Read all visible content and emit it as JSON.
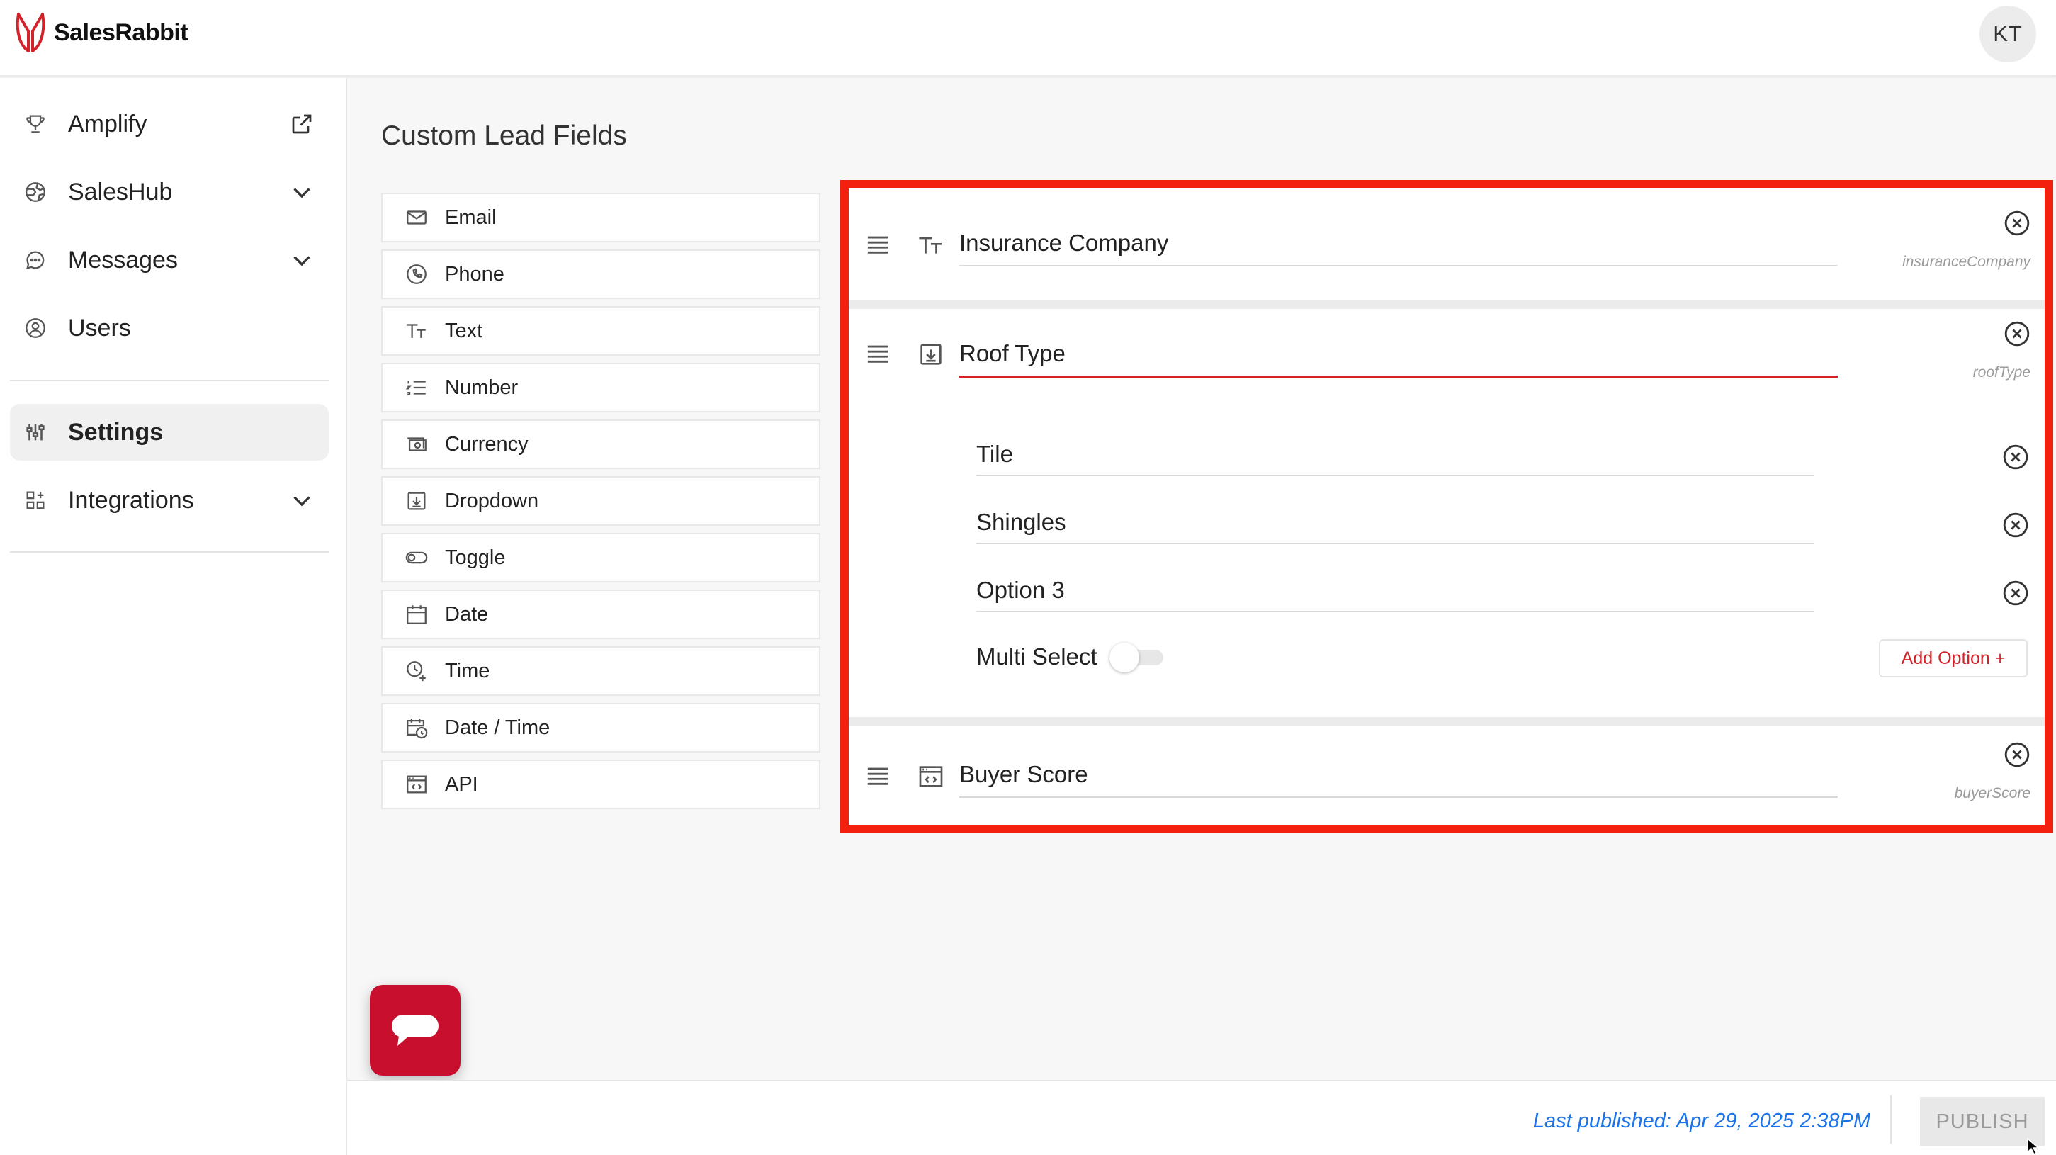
{
  "app": {
    "logo_text": "SalesRabbit",
    "avatar_initials": "KT"
  },
  "sidebar": {
    "items": [
      {
        "label": "Amplify",
        "icon": "trophy-icon",
        "trailing": "external-link-icon"
      },
      {
        "label": "SalesHub",
        "icon": "globe-icon",
        "trailing": "chevron-down-icon"
      },
      {
        "label": "Messages",
        "icon": "chat-bubble-icon",
        "trailing": "chevron-down-icon"
      },
      {
        "label": "Users",
        "icon": "user-circle-icon"
      },
      {
        "label": "Settings",
        "icon": "sliders-icon",
        "active": true
      },
      {
        "label": "Integrations",
        "icon": "grid-plus-icon",
        "trailing": "chevron-down-icon"
      }
    ]
  },
  "main": {
    "title": "Custom Lead Fields",
    "palette": [
      {
        "label": "Email",
        "icon": "envelope-icon"
      },
      {
        "label": "Phone",
        "icon": "phone-icon"
      },
      {
        "label": "Text",
        "icon": "text-icon"
      },
      {
        "label": "Number",
        "icon": "numbered-list-icon"
      },
      {
        "label": "Currency",
        "icon": "cash-icon"
      },
      {
        "label": "Dropdown",
        "icon": "dropdown-icon"
      },
      {
        "label": "Toggle",
        "icon": "toggle-icon"
      },
      {
        "label": "Date",
        "icon": "calendar-icon"
      },
      {
        "label": "Time",
        "icon": "clock-plus-icon"
      },
      {
        "label": "Date / Time",
        "icon": "calendar-clock-icon"
      },
      {
        "label": "API",
        "icon": "api-window-icon"
      }
    ],
    "fields": [
      {
        "name": "Insurance Company",
        "key": "insuranceCompany",
        "type_icon": "text-icon"
      },
      {
        "name": "Roof Type",
        "key": "roofType",
        "type_icon": "dropdown-icon",
        "options": [
          "Tile",
          "Shingles",
          "Option 3"
        ],
        "multi_select_label": "Multi Select",
        "multi_select": false,
        "add_option_label": "Add Option +"
      },
      {
        "name": "Buyer Score",
        "key": "buyerScore",
        "type_icon": "api-window-icon"
      }
    ]
  },
  "footer": {
    "last_published": "Last published: Apr 29, 2025 2:38PM",
    "publish_label": "PUBLISH"
  },
  "colors": {
    "accent_red": "#d2232a",
    "highlight_border": "#f4200f",
    "link_blue": "#1a73e8"
  }
}
